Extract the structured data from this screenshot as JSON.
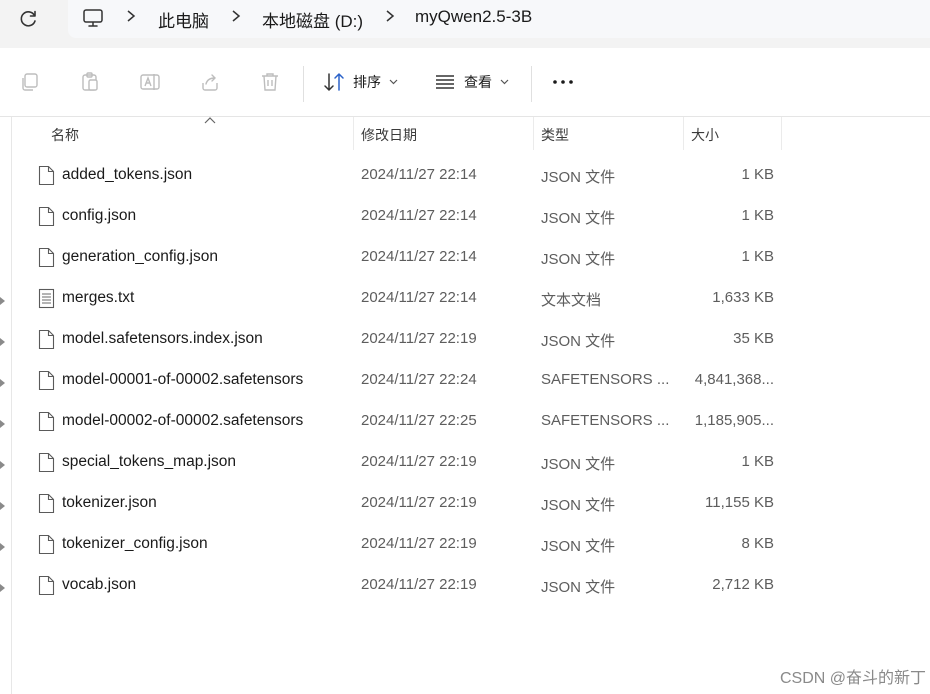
{
  "address_bar": {
    "pc_icon": "monitor-icon",
    "breadcrumbs": [
      "此电脑",
      "本地磁盘 (D:)",
      "myQwen2.5-3B"
    ]
  },
  "toolbar": {
    "sort_label": "排序",
    "view_label": "查看",
    "more_label": "..."
  },
  "columns": {
    "name": "名称",
    "date": "修改日期",
    "type": "类型",
    "size": "大小"
  },
  "files": [
    {
      "name": "added_tokens.json",
      "date": "2024/11/27 22:14",
      "type": "JSON 文件",
      "size": "1 KB",
      "icon": "file-icon"
    },
    {
      "name": "config.json",
      "date": "2024/11/27 22:14",
      "type": "JSON 文件",
      "size": "1 KB",
      "icon": "file-icon"
    },
    {
      "name": "generation_config.json",
      "date": "2024/11/27 22:14",
      "type": "JSON 文件",
      "size": "1 KB",
      "icon": "file-icon"
    },
    {
      "name": "merges.txt",
      "date": "2024/11/27 22:14",
      "type": "文本文档",
      "size": "1,633 KB",
      "icon": "text-file-icon"
    },
    {
      "name": "model.safetensors.index.json",
      "date": "2024/11/27 22:19",
      "type": "JSON 文件",
      "size": "35 KB",
      "icon": "file-icon"
    },
    {
      "name": "model-00001-of-00002.safetensors",
      "date": "2024/11/27 22:24",
      "type": "SAFETENSORS ...",
      "size": "4,841,368...",
      "icon": "file-icon"
    },
    {
      "name": "model-00002-of-00002.safetensors",
      "date": "2024/11/27 22:25",
      "type": "SAFETENSORS ...",
      "size": "1,185,905...",
      "icon": "file-icon"
    },
    {
      "name": "special_tokens_map.json",
      "date": "2024/11/27 22:19",
      "type": "JSON 文件",
      "size": "1 KB",
      "icon": "file-icon"
    },
    {
      "name": "tokenizer.json",
      "date": "2024/11/27 22:19",
      "type": "JSON 文件",
      "size": "11,155 KB",
      "icon": "file-icon"
    },
    {
      "name": "tokenizer_config.json",
      "date": "2024/11/27 22:19",
      "type": "JSON 文件",
      "size": "8 KB",
      "icon": "file-icon"
    },
    {
      "name": "vocab.json",
      "date": "2024/11/27 22:19",
      "type": "JSON 文件",
      "size": "2,712 KB",
      "icon": "file-icon"
    }
  ],
  "watermark": "CSDN @奋斗的新丁"
}
